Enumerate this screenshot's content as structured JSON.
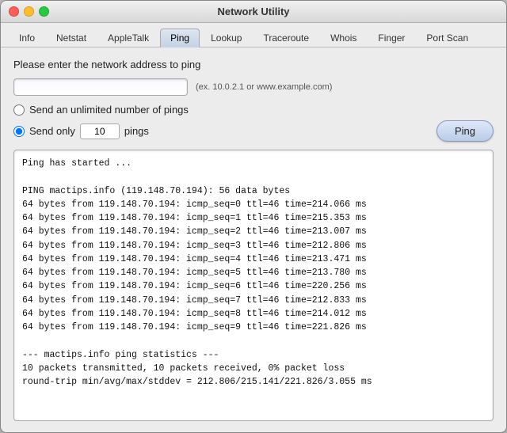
{
  "window": {
    "title": "Network Utility"
  },
  "tabs": [
    {
      "id": "info",
      "label": "Info",
      "active": false
    },
    {
      "id": "netstat",
      "label": "Netstat",
      "active": false
    },
    {
      "id": "appletalk",
      "label": "AppleTalk",
      "active": false
    },
    {
      "id": "ping",
      "label": "Ping",
      "active": true
    },
    {
      "id": "lookup",
      "label": "Lookup",
      "active": false
    },
    {
      "id": "traceroute",
      "label": "Traceroute",
      "active": false
    },
    {
      "id": "whois",
      "label": "Whois",
      "active": false
    },
    {
      "id": "finger",
      "label": "Finger",
      "active": false
    },
    {
      "id": "portscan",
      "label": "Port Scan",
      "active": false
    }
  ],
  "content": {
    "address_label": "Please enter the network address to ping",
    "address_placeholder": "",
    "address_hint": "(ex. 10.0.2.1 or www.example.com)",
    "radio_unlimited": "Send an unlimited number of pings",
    "radio_only": "Send only",
    "ping_count": "10",
    "pings_label": "pings",
    "ping_button": "Ping",
    "output": "Ping has started ...\n\nPING mactips.info (119.148.70.194): 56 data bytes\n64 bytes from 119.148.70.194: icmp_seq=0 ttl=46 time=214.066 ms\n64 bytes from 119.148.70.194: icmp_seq=1 ttl=46 time=215.353 ms\n64 bytes from 119.148.70.194: icmp_seq=2 ttl=46 time=213.007 ms\n64 bytes from 119.148.70.194: icmp_seq=3 ttl=46 time=212.806 ms\n64 bytes from 119.148.70.194: icmp_seq=4 ttl=46 time=213.471 ms\n64 bytes from 119.148.70.194: icmp_seq=5 ttl=46 time=213.780 ms\n64 bytes from 119.148.70.194: icmp_seq=6 ttl=46 time=220.256 ms\n64 bytes from 119.148.70.194: icmp_seq=7 ttl=46 time=212.833 ms\n64 bytes from 119.148.70.194: icmp_seq=8 ttl=46 time=214.012 ms\n64 bytes from 119.148.70.194: icmp_seq=9 ttl=46 time=221.826 ms\n\n--- mactips.info ping statistics ---\n10 packets transmitted, 10 packets received, 0% packet loss\nround-trip min/avg/max/stddev = 212.806/215.141/221.826/3.055 ms"
  }
}
